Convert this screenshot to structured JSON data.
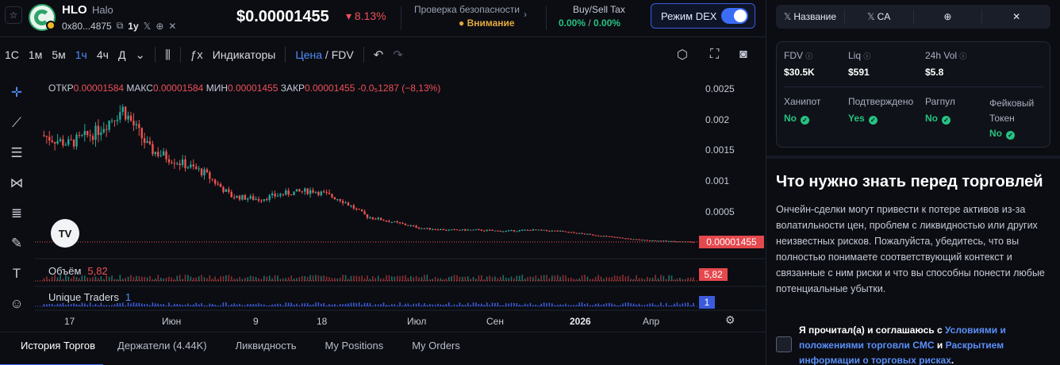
{
  "header": {
    "favorite_icon": "star-icon",
    "token_symbol": "HLO",
    "token_name": "Halo",
    "address": "0x80...4875",
    "age": "1y",
    "price": "$0.00001455",
    "change": "8.13%",
    "change_color": "#f0505a",
    "security_title": "Проверка безопасности",
    "security_value": "Внимание",
    "tax_title": "Buy/Sell Tax",
    "buy_tax": "0.00%",
    "sell_tax": "0.00%",
    "dex_mode_label": "Режим DEX",
    "dex_mode_on": true
  },
  "toolbar": {
    "intervals": [
      "1С",
      "1м",
      "5м",
      "1ч",
      "4ч",
      "Д"
    ],
    "active_interval": "1ч",
    "indicators_label": "Индикаторы",
    "price_label": "Цена",
    "fdv_label": "FDV"
  },
  "chart": {
    "ohlc": {
      "open_label": "ОТКР",
      "open": "0.00001584",
      "high_label": "МАКС",
      "high": "0.00001584",
      "low_label": "МИН",
      "low": "0.00001455",
      "close_label": "ЗАКР",
      "close": "0.00001455",
      "delta": "-0.0₅1287 (−8,13%)"
    },
    "y_ticks": [
      "0.0025",
      "0.002",
      "0.0015",
      "0.001",
      "0.0005"
    ],
    "current_price_tag": "0.00001455",
    "volume_label": "Объём",
    "volume_value": "5,82",
    "volume_tag": "5,82",
    "traders_label": "Unique Traders",
    "traders_value": "1",
    "traders_tag": "1",
    "x_ticks": [
      "17",
      "Июн",
      "9",
      "18",
      "Июл",
      "Сен",
      "2026",
      "Апр"
    ],
    "tv_logo": "TV"
  },
  "chart_data": {
    "type": "line",
    "title": "",
    "xlabel": "",
    "ylabel": "",
    "ylim": [
      0,
      0.0027
    ],
    "x": [
      "17",
      "",
      "",
      "",
      "",
      "Июн",
      "",
      "",
      "9",
      "",
      "",
      "18",
      "",
      "",
      "",
      "Июл",
      "",
      "",
      "Сен",
      "",
      "",
      "2026",
      "",
      "Апр",
      ""
    ],
    "series": [
      {
        "values": [
          0.00185,
          0.0017,
          0.0019,
          0.0023,
          0.0016,
          0.0014,
          0.0012,
          0.0008,
          0.00075,
          0.00085,
          0.0009,
          0.00075,
          0.00045,
          0.00035,
          0.00025,
          0.00022,
          0.00022,
          0.0002,
          0.00022,
          0.0002,
          0.00015,
          0.0001,
          5e-05,
          3e-05,
          1.455e-05
        ]
      }
    ]
  },
  "bottom_tabs": [
    "История Торгов",
    "Держатели (4.44K)",
    "Ликвидность",
    "My Positions",
    "My Orders"
  ],
  "right_panel": {
    "tabs": [
      {
        "icon": "x-search-icon",
        "label": "Название"
      },
      {
        "icon": "x-search-icon",
        "label": "CA"
      },
      {
        "icon": "globe-icon",
        "label": ""
      },
      {
        "icon": "x-icon",
        "label": ""
      }
    ],
    "stats": {
      "fdv_label": "FDV",
      "fdv": "$30.5K",
      "liq_label": "Liq",
      "liq": "$591",
      "vol_label": "24h Vol",
      "vol": "$5.8",
      "honeypot_label": "Ханипот",
      "honeypot": "No",
      "verified_label": "Подтверждено",
      "verified": "Yes",
      "rugpull_label": "Рагпул",
      "rugpull": "No",
      "fake_label": "Фейковый Токен",
      "fake": "No"
    },
    "warning_title": "Что нужно знать перед торговлей",
    "warning_text": "Ончейн-сделки могут привести к потере активов из-за волатильности цен, проблем с ликвидностью или других неизвестных рисков. Пожалуйста, убедитесь, что вы полностью понимаете соответствующий контекст и связанные с ним риски и что вы способны понести любые потенциальные убытки.",
    "agree_prefix": "Я прочитал(а) и соглашаюсь с ",
    "agree_link1": "Условиями и положениями торговли CMC",
    "agree_mid": " и ",
    "agree_link2": "Раскрытием информации о торговых рисках",
    "agree_suffix": "."
  }
}
